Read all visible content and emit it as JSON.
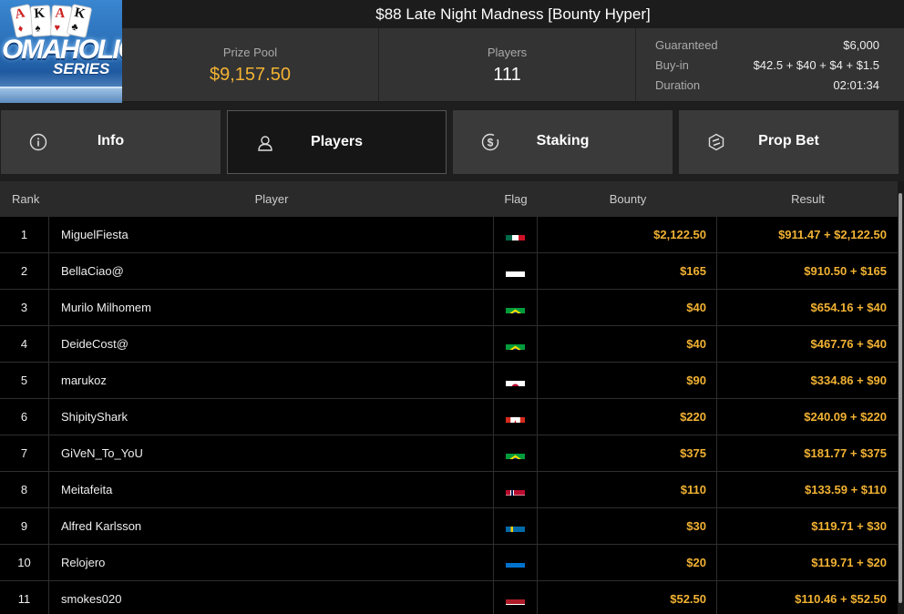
{
  "header": {
    "logo": {
      "word1": "OMAHOLIC",
      "word2": "SERIES",
      "cards": [
        "A",
        "K",
        "A",
        "K"
      ]
    },
    "title": "$88 Late Night Madness [Bounty Hyper]",
    "prize_pool_label": "Prize Pool",
    "prize_pool_value": "$9,157.50",
    "players_label": "Players",
    "players_value": "111",
    "details": [
      {
        "key": "Guaranteed",
        "value": "$6,000"
      },
      {
        "key": "Buy-in",
        "value": "$42.5 + $40 + $4 + $1.5"
      },
      {
        "key": "Duration",
        "value": "02:01:34"
      }
    ]
  },
  "tabs": [
    {
      "label": "Info",
      "icon": "info-icon",
      "active": false
    },
    {
      "label": "Players",
      "icon": "user-icon",
      "active": true
    },
    {
      "label": "Staking",
      "icon": "dollar-coin-icon",
      "active": false
    },
    {
      "label": "Prop Bet",
      "icon": "prop-bet-icon",
      "active": false
    }
  ],
  "table": {
    "columns": [
      "Rank",
      "Player",
      "Flag",
      "Bounty",
      "Result"
    ],
    "rows": [
      {
        "rank": "1",
        "player": "MiguelFiesta",
        "flag": "mexico-flag-icon",
        "bounty": "$2,122.50",
        "result": "$911.47 + $2,122.50"
      },
      {
        "rank": "2",
        "player": "BellaCiao@",
        "flag": "poland-flag-icon",
        "bounty": "$165",
        "result": "$910.50 + $165"
      },
      {
        "rank": "3",
        "player": "Murilo Milhomem",
        "flag": "brazil-flag-icon",
        "bounty": "$40",
        "result": "$654.16 + $40"
      },
      {
        "rank": "4",
        "player": "DeideCost@",
        "flag": "brazil-flag-icon",
        "bounty": "$40",
        "result": "$467.76 + $40"
      },
      {
        "rank": "5",
        "player": "marukoz",
        "flag": "japan-flag-icon",
        "bounty": "$90",
        "result": "$334.86 + $90"
      },
      {
        "rank": "6",
        "player": "ShipityShark",
        "flag": "canada-flag-icon",
        "bounty": "$220",
        "result": "$240.09 + $220"
      },
      {
        "rank": "7",
        "player": "GiVeN_To_YoU",
        "flag": "brazil-flag-icon",
        "bounty": "$375",
        "result": "$181.77 + $375"
      },
      {
        "rank": "8",
        "player": "Meitafeita",
        "flag": "norway-flag-icon",
        "bounty": "$110",
        "result": "$133.59 + $110"
      },
      {
        "rank": "9",
        "player": "Alfred Karlsson",
        "flag": "sweden-flag-icon",
        "bounty": "$30",
        "result": "$119.71 + $30"
      },
      {
        "rank": "10",
        "player": "Relojero",
        "flag": "estonia-flag-icon",
        "bounty": "$20",
        "result": "$119.71 + $20"
      },
      {
        "rank": "11",
        "player": "smokes020",
        "flag": "netherlands-flag-icon",
        "bounty": "$52.50",
        "result": "$110.46 + $52.50"
      }
    ]
  },
  "colors": {
    "accent": "#f2b233",
    "panel": "#333333",
    "tab": "#3a3a3a"
  }
}
